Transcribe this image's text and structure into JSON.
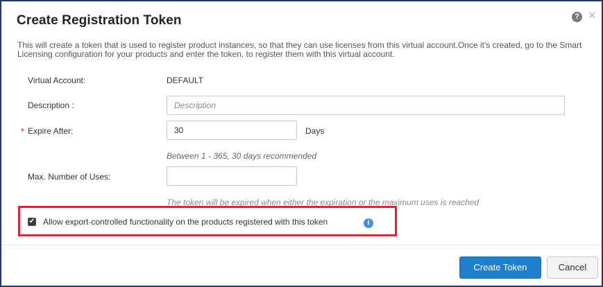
{
  "dialog": {
    "title": "Create Registration Token",
    "help_icon": "?",
    "close_icon": "×",
    "intro_text": "This will create a token that is used to register product instances, so that they can use licenses from this virtual account.Once it's created, go to the Smart Licensing configuration for your products and enter the token, to register them with this virtual account."
  },
  "form": {
    "virtual_account_label": "Virtual Account:",
    "virtual_account_value": "DEFAULT",
    "description_label": "Description :",
    "description_placeholder": "Description",
    "description_value": "",
    "required_marker": "*",
    "expire_after_label": "Expire After:",
    "expire_after_value": "30",
    "expire_unit": "Days",
    "expire_hint": "Between 1 - 365, 30 days recommended",
    "max_uses_label": "Max. Number of Uses:",
    "max_uses_value": "",
    "max_uses_hint": "The token will be expired when either the expiration or the maximum uses is reached",
    "export_checkbox_checked": true,
    "export_checkbox_mark": "✔",
    "export_checkbox_label": "Allow export-controlled functionality on the products registered with this token",
    "info_icon": "i"
  },
  "footer": {
    "create_label": "Create Token",
    "cancel_label": "Cancel"
  },
  "colors": {
    "primary_button": "#1f7fcf",
    "highlight_border": "#d7263d",
    "required_marker": "#cc2222",
    "info_icon": "#4a90d9"
  }
}
